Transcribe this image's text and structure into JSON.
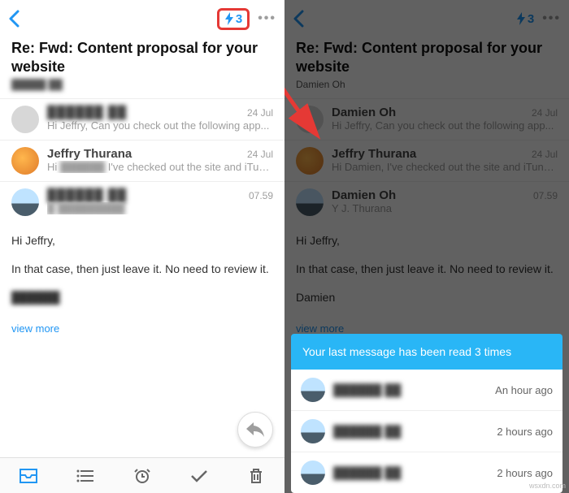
{
  "left": {
    "header": {
      "bolt_count": "3",
      "more": "•••"
    },
    "subject": "Re: Fwd: Content proposal for your website",
    "subsender": "█████ ██",
    "thread": [
      {
        "name": "██████ ██",
        "date": "24 Jul",
        "preview_prefix": "Hi Jeffry, Can you check out the following app...",
        "preview_blur": ""
      },
      {
        "name": "Jeffry Thurana",
        "date": "24 Jul",
        "preview_prefix": "Hi ",
        "preview_blur": "██████",
        "preview_suffix": " I've checked out the site and iTune..."
      },
      {
        "name": "██████ ██",
        "date": "07.59",
        "preview_prefix": "",
        "preview_blur": "█ █████████"
      }
    ],
    "message": {
      "greeting": "Hi Jeffry,",
      "body": "In that case, then just leave it. No need to review it.",
      "signature": "██████"
    },
    "view_more": "view more"
  },
  "right": {
    "header": {
      "bolt_count": "3",
      "more": "•••"
    },
    "subject": "Re: Fwd: Content proposal for your website",
    "subsender": "Damien Oh",
    "thread": [
      {
        "name": "Damien Oh",
        "date": "24 Jul",
        "preview": "Hi Jeffry, Can you check out the following app..."
      },
      {
        "name": "Jeffry Thurana",
        "date": "24 Jul",
        "preview": "Hi Damien, I've checked out the site and iTune..."
      },
      {
        "name": "Damien Oh",
        "date": "07.59",
        "preview": "Y J. Thurana"
      }
    ],
    "message": {
      "greeting": "Hi Jeffry,",
      "body": "In that case, then just leave it. No need to review it.",
      "signature": "Damien"
    },
    "view_more": "view more",
    "sheet": {
      "banner": "Your last message has been read 3 times",
      "rows": [
        {
          "name": "██████ ██",
          "time": "An hour ago"
        },
        {
          "name": "██████ ██",
          "time": "2 hours ago"
        },
        {
          "name": "██████ ██",
          "time": "2 hours ago"
        }
      ]
    }
  },
  "watermark": "wsxdn.com"
}
